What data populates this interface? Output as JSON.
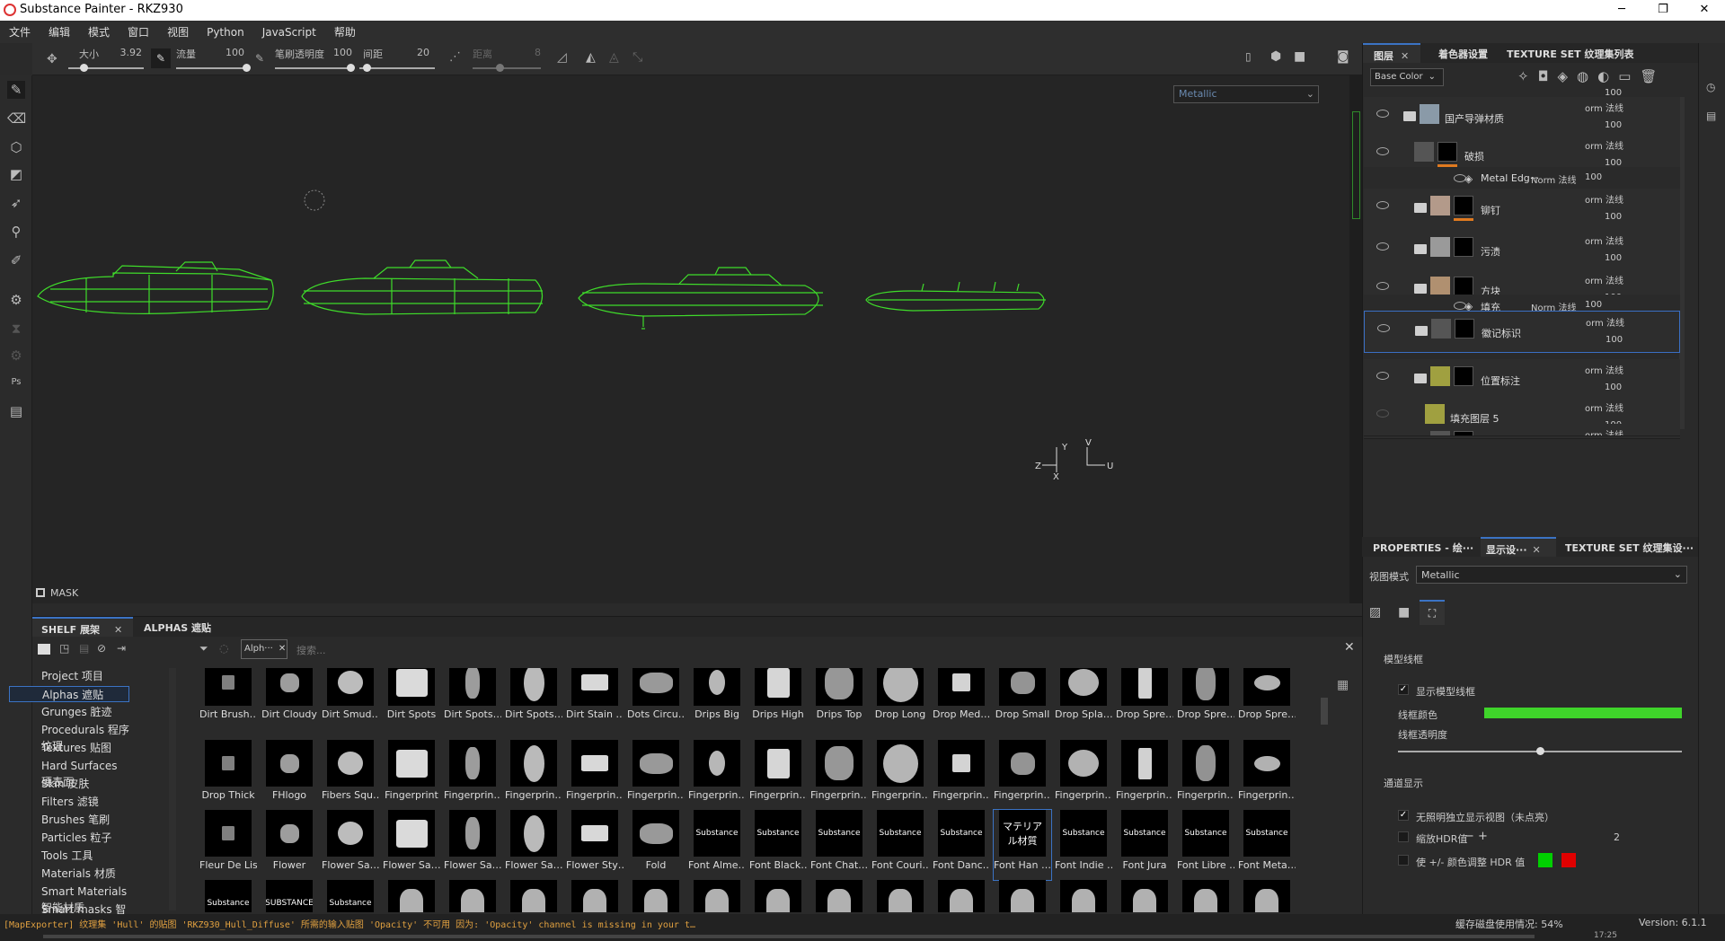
{
  "titlebar": {
    "title": "Substance Painter - RKZ930"
  },
  "menu": [
    "文件",
    "编辑",
    "模式",
    "窗口",
    "视图",
    "Python",
    "JavaScript",
    "帮助"
  ],
  "toolbar": {
    "size_label": "大小",
    "size_value": "3.92",
    "flow_label": "流量",
    "flow_value": "100",
    "opacity_label": "笔刷透明度",
    "opacity_value": "100",
    "spacing_label": "间距",
    "spacing_value": "20",
    "distance_label": "距离",
    "distance_value": "8",
    "size_pct": 0.2,
    "flow_pct": 1.0,
    "opacity_pct": 1.0,
    "spacing_pct": 0.1,
    "distance_pct": 0.4
  },
  "viewport": {
    "channel": "Metallic",
    "mask_label": "MASK",
    "axis_y": "Y",
    "axis_z": "Z",
    "axis_x": "X",
    "axis_v": "V",
    "axis_u": "U",
    "wire_color": "#3fdc2a"
  },
  "shelf": {
    "tab1": "SHELF 展架",
    "tab2": "ALPHAS 遮贴",
    "filter_chip": "Alph···",
    "search_placeholder": "搜索...",
    "categories": [
      "Project 项目",
      "Alphas 遮贴",
      "Grunges 脏迹",
      "Procedurals 程序纹理",
      "Textures 贴图",
      "Hard Surfaces 硬表面",
      "Skin 皮肤",
      "Filters 滤镜",
      "Brushes 笔刷",
      "Particles 粒子",
      "Tools 工具",
      "Materials 材质",
      "Smart Materials 智能材质",
      "Smart masks 智能遮罩"
    ],
    "selected_category": "Alphas 遮贴",
    "row1": [
      "Dirt Brush…",
      "Dirt Cloudy",
      "Dirt Smud…",
      "Dirt Spots",
      "Dirt Spots…",
      "Dirt Spots…",
      "Dirt Stain …",
      "Dots Circu…",
      "Drips Big",
      "Drips High",
      "Drips Top",
      "Drop Long",
      "Drop Med…",
      "Drop Small",
      "Drop Spla…",
      "Drop Spre…",
      "Drop Spre…",
      "Drop Spre…"
    ],
    "row2": [
      "Drop Thick",
      "FHlogo",
      "Fibers Squ…",
      "Fingerprint",
      "Fingerprin…",
      "Fingerprin…",
      "Fingerprin…",
      "Fingerprin…",
      "Fingerprin…",
      "Fingerprin…",
      "Fingerprin…",
      "Fingerprin…",
      "Fingerprin…",
      "Fingerprin…",
      "Fingerprin…",
      "Fingerprin…",
      "Fingerprin…",
      "Fingerprin…"
    ],
    "row3": [
      "Fleur De Lis",
      "Flower",
      "Flower Sa…",
      "Flower Sa…",
      "Flower Sa…",
      "Flower Sa…",
      "Flower Sty…",
      "Fold",
      "Font Alme…",
      "Font Black…",
      "Font Chat…",
      "Font Couri…",
      "Font Danc…",
      "Font Han …",
      "Font Indie …",
      "Font Jura",
      "Font Libre …",
      "Font Meta…"
    ],
    "font_samples": [
      "Substance",
      "Substance",
      "Substance",
      "Substance",
      "Substance",
      "マテリアル材質",
      "Substance",
      "Substance",
      "Substance",
      "Substance"
    ],
    "row4_texts": [
      "Substance",
      "SUBSTANCE",
      "Substance"
    ]
  },
  "status": {
    "message": "[MapExporter] 纹理集 'Hull' 的贴图 'RKZ930_Hull_Diffuse' 所需的输入贴图 'Opacity' 不可用 因为: 'Opacity' channel is missing in your t…",
    "cache": "缓存磁盘使用情况:  54%",
    "version": "Version: 6.1.1",
    "clock": "17:25"
  },
  "layers_panel": {
    "tab1": "图层",
    "tab2": "着色器设置",
    "tab3": "TEXTURE SET 纹理集列表",
    "channel": "Base Color",
    "rows": [
      {
        "name": "",
        "mode": "",
        "opacity": "100"
      },
      {
        "name": "国产导弹材质",
        "mode": "orm 法线",
        "opacity": "100"
      },
      {
        "name": "破损",
        "mode": "orm 法线",
        "opacity": "100"
      },
      {
        "name": "Metal Edg···",
        "mode": "Norm 法线",
        "opacity": "100"
      },
      {
        "name": "铆钉",
        "mode": "orm 法线",
        "opacity": "100"
      },
      {
        "name": "污渍",
        "mode": "orm 法线",
        "opacity": "100"
      },
      {
        "name": "方块",
        "mode": "orm 法线",
        "opacity": "100"
      },
      {
        "name": "填充",
        "mode": "Norm 法线",
        "opacity": "100"
      },
      {
        "name": "徽记标识",
        "mode": "orm 法线",
        "opacity": "100"
      },
      {
        "name": "位置标注",
        "mode": "orm 法线",
        "opacity": "100"
      },
      {
        "name": "填充图层 5",
        "mode": "orm 法线",
        "opacity": "100"
      },
      {
        "name": "黑色金属",
        "mode": "orm 法线",
        "opacity": ""
      }
    ]
  },
  "props_panel": {
    "tab1": "PROPERTIES - 绘···",
    "tab2": "显示设···",
    "tab3": "TEXTURE SET 纹理集设···",
    "view_mode_label": "视图模式",
    "view_mode": "Metallic",
    "section1": "模型线框",
    "show_wire": "显示模型线框",
    "wire_color_label": "线框颜色",
    "wire_opacity_label": "线框透明度",
    "wire_color": "#3fd42a",
    "wire_opacity_pct": 0.5,
    "section2": "通道显示",
    "opt1": "无照明独立显示视图（未点亮）",
    "opt2": "缩放HDR值",
    "opt2_value": "2",
    "opt3": "使 +/- 颜色调整 HDR 值",
    "green": "#00d000",
    "red": "#e00000"
  }
}
